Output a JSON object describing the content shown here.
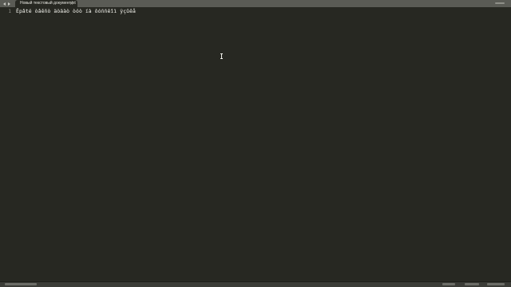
{
  "tab": {
    "title": "Новый текстовый документ.txt",
    "close_glyph": "×"
  },
  "editor": {
    "line_number": "1",
    "line_text": "Ëpâté òâêñò äòäàò òóò íà ôóññêîì ÿçûêå"
  },
  "icons": {
    "nav_back": "arrow-left-icon",
    "nav_forward": "arrow-right-icon",
    "tab_close": "close-icon",
    "tab_overflow": "menu-icon",
    "mouse_cursor": "text-cursor-icon"
  },
  "colors": {
    "background": "#272822",
    "tabbar": "#5a5b55",
    "text": "#f8f8f2",
    "gutter_text": "#8f908a"
  }
}
